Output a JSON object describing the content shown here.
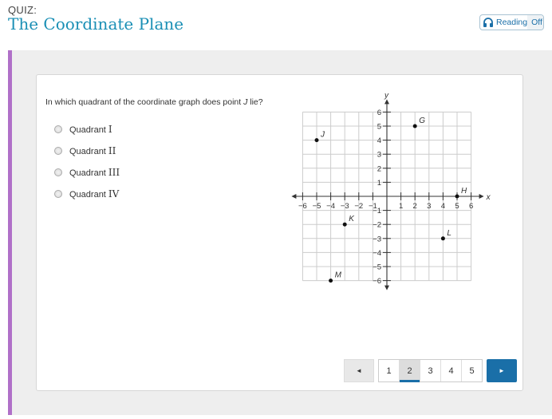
{
  "header": {
    "quiz_label": "QUIZ:",
    "title": "The Coordinate Plane",
    "reading_label": "Reading",
    "reading_state": "Off",
    "accent_color": "#1a8fb5"
  },
  "question": {
    "text_before": "In which quadrant of the coordinate graph does point ",
    "point": "J",
    "text_after": " lie?",
    "options": [
      {
        "label": "Quadrant",
        "numeral": "I"
      },
      {
        "label": "Quadrant",
        "numeral": "II"
      },
      {
        "label": "Quadrant",
        "numeral": "III"
      },
      {
        "label": "Quadrant",
        "numeral": "IV"
      }
    ]
  },
  "graph": {
    "x_label": "x",
    "y_label": "y",
    "x_range": [
      -6,
      6
    ],
    "y_range": [
      -6,
      6
    ],
    "x_ticks": [
      "-6",
      "-5",
      "-4",
      "-3",
      "-2",
      "-1",
      "1",
      "2",
      "3",
      "4",
      "5",
      "6"
    ],
    "y_ticks": [
      "6",
      "5",
      "4",
      "3",
      "2",
      "1",
      "-1",
      "-2",
      "-3",
      "-4",
      "-5",
      "-6"
    ],
    "points": [
      {
        "name": "J",
        "x": -5,
        "y": 4
      },
      {
        "name": "G",
        "x": 2,
        "y": 5
      },
      {
        "name": "H",
        "x": 5,
        "y": 0
      },
      {
        "name": "K",
        "x": -3,
        "y": -2
      },
      {
        "name": "L",
        "x": 4,
        "y": -3
      },
      {
        "name": "M",
        "x": -4,
        "y": -6
      }
    ]
  },
  "pager": {
    "prev_icon": "◄",
    "next_icon": "►",
    "pages": [
      "1",
      "2",
      "3",
      "4",
      "5"
    ],
    "current": "2",
    "active_color": "#1a6fa8"
  }
}
